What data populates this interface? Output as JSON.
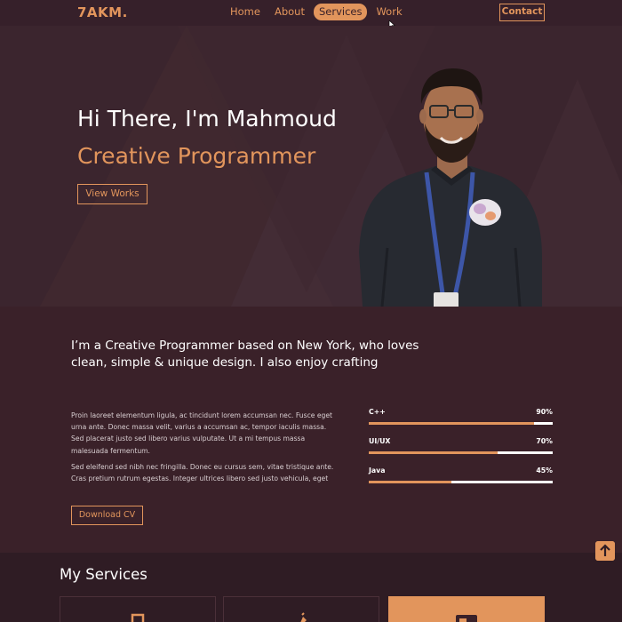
{
  "nav": {
    "logo": "7AKM.",
    "links": [
      {
        "label": "Home"
      },
      {
        "label": "About"
      },
      {
        "label": "Services",
        "active": true
      },
      {
        "label": "Work"
      }
    ],
    "contact_label": "Contact"
  },
  "hero": {
    "greeting": "Hi There, I'm Mahmoud",
    "role": "Creative Programmer",
    "cta_label": "View Works"
  },
  "about": {
    "heading": "I’m a Creative Programmer based on New York, who loves clean, simple & unique design. I also enjoy crafting",
    "paragraph1": "Proin laoreet elementum ligula, ac tincidunt lorem accumsan nec. Fusce eget urna ante. Donec massa velit, varius a accumsan ac, tempor iaculis massa. Sed placerat justo sed libero varius vulputate. Ut a mi tempus massa malesuada fermentum.",
    "paragraph2": "Sed eleifend sed nibh nec fringilla. Donec eu cursus sem, vitae tristique ante. Cras pretium rutrum egestas. Integer ultrices libero sed justo vehicula, eget",
    "download_label": "Download CV",
    "skills": [
      {
        "name": "C++",
        "percent_label": "90%",
        "percent": 90
      },
      {
        "name": "UI/UX",
        "percent_label": "70%",
        "percent": 70
      },
      {
        "name": "Java",
        "percent_label": "45%",
        "percent": 45
      }
    ]
  },
  "services": {
    "title": "My Services"
  },
  "colors": {
    "accent": "#e2955c",
    "background": "#3a2129",
    "hero_background": "#3b252e"
  },
  "icons": [
    "cursor-icon",
    "scroll-top-arrow-icon",
    "service-mobile-icon",
    "service-pen-icon",
    "service-layout-icon"
  ]
}
